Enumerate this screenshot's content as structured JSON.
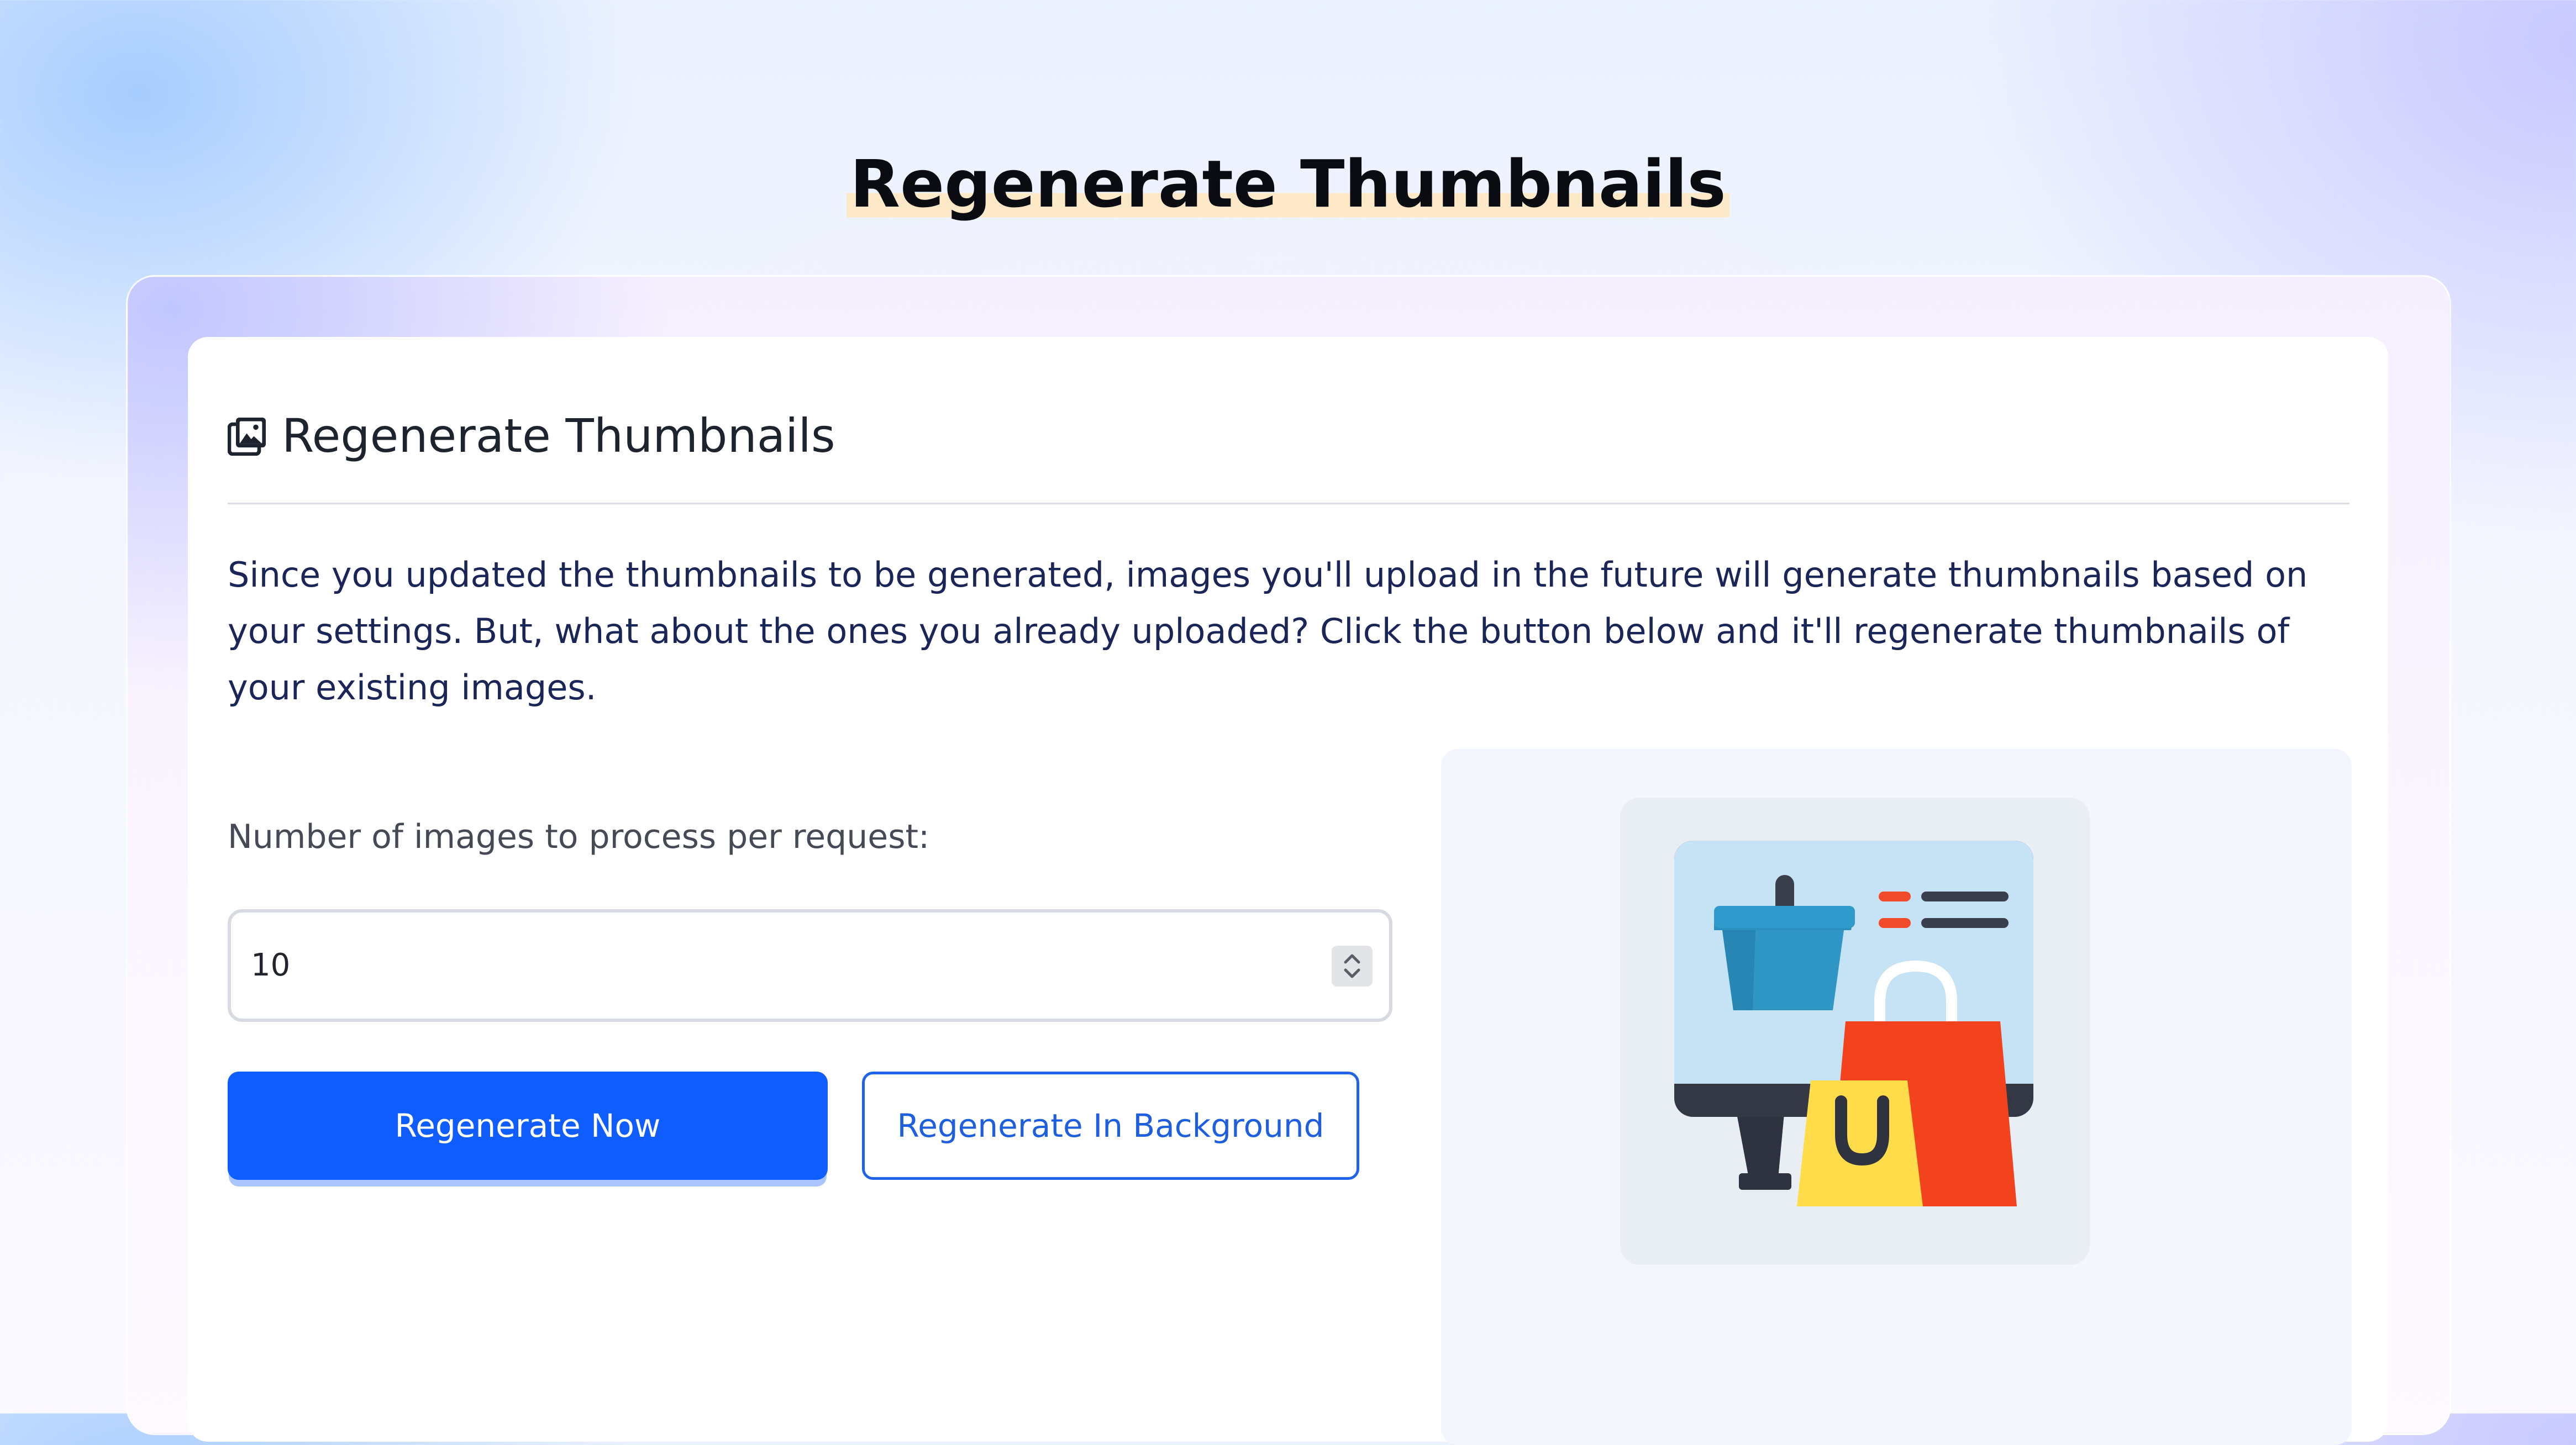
{
  "hero": {
    "title": "Regenerate Thumbnails"
  },
  "card": {
    "icon": "images-icon",
    "title": "Regenerate Thumbnails",
    "description": "Since you updated the thumbnails to be generated, images you'll upload in the future will generate thumbnails based on your settings. But, what about the ones you already uploaded? Click the button below and it'll regenerate thumbnails of your existing images."
  },
  "form": {
    "label": "Number of images to process per request:",
    "value": "10"
  },
  "buttons": {
    "primary": "Regenerate Now",
    "secondary": "Regenerate In Background"
  },
  "illustration": {
    "icon": "online-shopping-icon"
  },
  "colors": {
    "primary": "#0f5cff",
    "text_dark": "#1a2558",
    "highlight": "#fde9c7"
  }
}
